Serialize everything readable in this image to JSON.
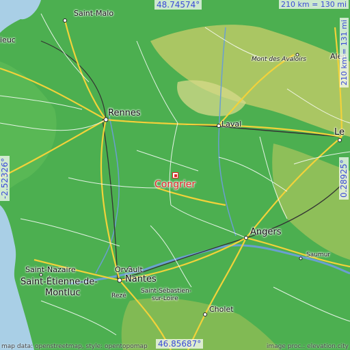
{
  "map": {
    "target": {
      "name": "Congrier",
      "color": "#e02424"
    },
    "coordinates": {
      "top_lat": "48.74574°",
      "bottom_lat": "46.85687°",
      "left_lon": "-2.52326°",
      "right_lon": "0.28925°"
    },
    "scale": {
      "horizontal": "210 km = 130 mi",
      "vertical": "210 km = 131 mi"
    },
    "cities": {
      "saint_malo": "Saint-Malo",
      "dieuc": "ieuc",
      "alen": "Alen",
      "mont_des_avaloirs": "Mont des Avaloirs",
      "rennes": "Rennes",
      "laval": "Laval",
      "le": "Le",
      "angers": "Angers",
      "saint_nazaire": "Saint-Nazaire",
      "orvault": "Orvault",
      "saint_etienne_1": "Saint-Étienne-de-",
      "saint_etienne_2": "Montluc",
      "nantes": "Nantes",
      "reze": "Rezé",
      "saint_sebastien_1": "Saint-Sébastien-",
      "saint_sebastien_2": "sur-Loire",
      "cholet": "Cholet",
      "saumur": "Saumur"
    },
    "credits": {
      "left": "map data: openstreetmap, style: opentopomap",
      "right": "image proc.: elevation.city"
    },
    "colors": {
      "lowland": "#4caf50",
      "upland": "#c8d36a",
      "sea": "#a9cfe6",
      "river": "#6a9fd1",
      "major_road": "#f2d23a",
      "road": "#ffffff",
      "rail": "#333333"
    }
  }
}
